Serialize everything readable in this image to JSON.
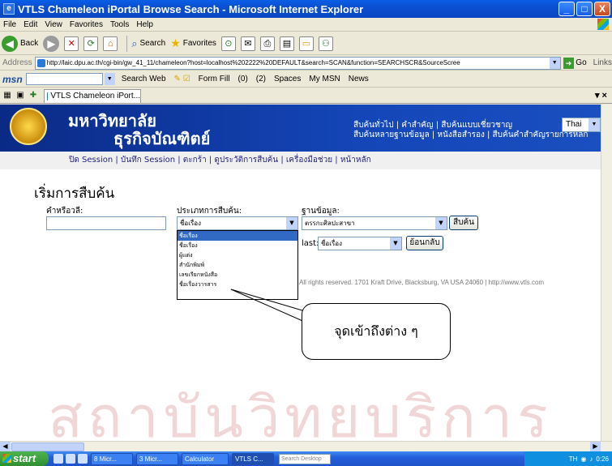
{
  "window": {
    "title": "VTLS Chameleon iPortal Browse Search - Microsoft Internet Explorer",
    "controls": {
      "minimize": "_",
      "maximize": "□",
      "close": "X"
    }
  },
  "menu": [
    "File",
    "Edit",
    "View",
    "Favorites",
    "Tools",
    "Help"
  ],
  "toolbar": {
    "back_label": "Back",
    "search_label": "Search",
    "favorites_label": "Favorites"
  },
  "address": {
    "label": "Address",
    "url": "http://laic.dpu.ac.th/cgi-bin/gw_41_11/chameleon?host=localhost%202222%20DEFAULT&search=SCAN&function=SEARCHSCR&SourceScree",
    "go_label": "Go",
    "links_label": "Links"
  },
  "msnbar": {
    "logo": "msn",
    "search_web": "Search Web",
    "form_fill": "Form Fill",
    "mail_count": "(0)",
    "other_count": "(2)",
    "spaces": "Spaces",
    "my_msn": "My MSN",
    "news": "News"
  },
  "tabs": [
    {
      "label": "VTLS Chameleon iPort..."
    }
  ],
  "banner": {
    "uni_line1": "มหาวิทยาลัย",
    "uni_line2": "ธุรกิจบัณฑิตย์",
    "links_line1": "สืบค้นทั่วไป | คำสำคัญ | สืบค้นแบบเชี่ยวชาญ",
    "links_line2": "สืบค้นหลายฐานข้อมูล | หนังสือสำรอง | สืบค้นคำสำคัญรายการหลัก",
    "lang": "Thai"
  },
  "session_nav": "ปิด Session | บันทึก Session | ตะกร้า | ดูประวัติการสืบค้น | เครื่องมือช่วย | หน้าหลัก",
  "form": {
    "heading": "เริ่มการสืบค้น",
    "keyword_label": "คำหรือวลี:",
    "type_label": "ประเภทการสืบค้น:",
    "db_label": "ฐานข้อมูล:",
    "type_selected": "ชื่อเรื่อง",
    "db_selected": "ตรรกะศิลปะสาขา",
    "search_button": "สืบค้น",
    "last_label": "last:",
    "last_selected": "ชื่อเรื่อง",
    "back_button": "ย้อนกลับ"
  },
  "dropdown_options": [
    "ชื่อเรื่อง",
    "ชื่อเรื่อง",
    "ผู้แต่ง",
    "สำนักพิมพ์",
    "เลขเรียกหนังสือ",
    "ชื่อเรื่องวารสาร"
  ],
  "footer": "All rights reserved. 1701 Kraft Drive, Blacksburg, VA USA 24060 | http://www.vtls.com",
  "watermark": "สถาบันวิทยบริการ",
  "callout": "จุดเข้าถึงต่าง ๆ",
  "taskbar": {
    "start": "start",
    "tasks": [
      "8 Micr...",
      "3 Micr...",
      "Calculator",
      "VTLS C..."
    ],
    "search_placeholder": "Search Desktop",
    "tray_lang": "TH",
    "clock": "0:26"
  },
  "colors": {
    "titlebar": "#0b4fd0",
    "banner": "#1446b8",
    "selection": "#316ac5"
  }
}
